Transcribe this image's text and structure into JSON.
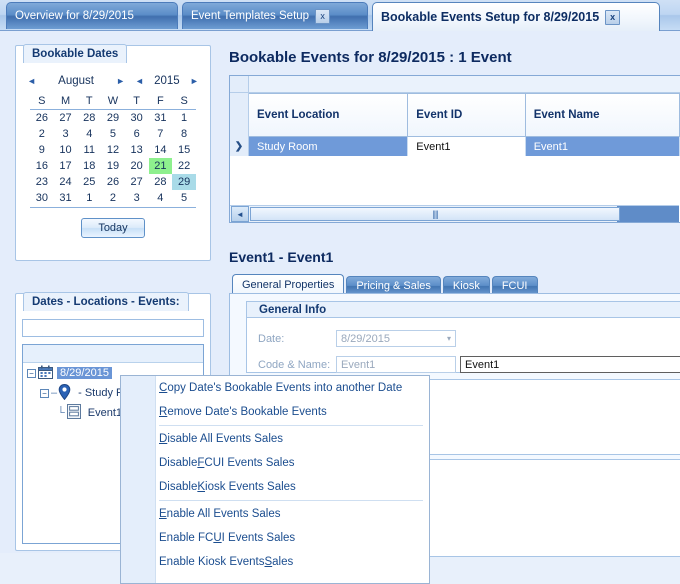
{
  "window_tabs": [
    {
      "label": "Overview for 8/29/2015",
      "closable": false,
      "active": false
    },
    {
      "label": "Event Templates Setup",
      "closable": true,
      "close_label": "x",
      "active": false
    },
    {
      "label": "Bookable Events Setup for 8/29/2015",
      "closable": true,
      "close_label": "x",
      "active": true
    }
  ],
  "bookable_dates": {
    "group_title": "Bookable Dates",
    "calendar": {
      "month": "August",
      "year": "2015",
      "prev_month_icon": "◄",
      "next_month_icon": "►",
      "prev_year_icon": "◄",
      "next_year_icon": "►",
      "daynames": [
        "S",
        "M",
        "T",
        "W",
        "T",
        "F",
        "S"
      ],
      "weeks": [
        [
          {
            "d": "26"
          },
          {
            "d": "27"
          },
          {
            "d": "28"
          },
          {
            "d": "29"
          },
          {
            "d": "30"
          },
          {
            "d": "31"
          },
          {
            "d": "1"
          }
        ],
        [
          {
            "d": "2"
          },
          {
            "d": "3"
          },
          {
            "d": "4"
          },
          {
            "d": "5"
          },
          {
            "d": "6"
          },
          {
            "d": "7"
          },
          {
            "d": "8"
          }
        ],
        [
          {
            "d": "9"
          },
          {
            "d": "10"
          },
          {
            "d": "11"
          },
          {
            "d": "12"
          },
          {
            "d": "13"
          },
          {
            "d": "14"
          },
          {
            "d": "15"
          }
        ],
        [
          {
            "d": "16"
          },
          {
            "d": "17"
          },
          {
            "d": "18"
          },
          {
            "d": "19"
          },
          {
            "d": "20"
          },
          {
            "d": "21",
            "hl": "green"
          },
          {
            "d": "22"
          }
        ],
        [
          {
            "d": "23"
          },
          {
            "d": "24"
          },
          {
            "d": "25"
          },
          {
            "d": "26"
          },
          {
            "d": "27"
          },
          {
            "d": "28"
          },
          {
            "d": "29",
            "hl": "blue"
          }
        ],
        [
          {
            "d": "30"
          },
          {
            "d": "31"
          },
          {
            "d": "1"
          },
          {
            "d": "2"
          },
          {
            "d": "3"
          },
          {
            "d": "4"
          },
          {
            "d": "5"
          }
        ]
      ],
      "today_button": "Today",
      "highlight_colors": {
        "selected_green": "#8ef08e",
        "active_blue": "#a9dbe8"
      }
    }
  },
  "tree_panel": {
    "group_title": "Dates - Locations - Events:",
    "search_value": "",
    "nodes": [
      {
        "icon": "calendar-icon",
        "label": "8/29/2015",
        "selected": true,
        "expander": "−"
      },
      {
        "icon": "map-pin-icon",
        "label": "- Study Room",
        "selected": false,
        "expander": "−"
      },
      {
        "icon": "event-card-icon",
        "label": "Event1",
        "selected": false,
        "expander": ""
      }
    ]
  },
  "events_grid": {
    "title": "Bookable Events for 8/29/2015  :  1 Event",
    "columns": [
      "Event Location",
      "Event ID",
      "Event Name"
    ],
    "row_indicator": "❯",
    "rows": [
      {
        "location": "Study Room",
        "id": "Event1",
        "name": "Event1"
      }
    ],
    "scrollbar": {
      "left_arrow": "◄",
      "grip": "||||"
    }
  },
  "detail": {
    "title": "Event1  -  Event1",
    "tabs": [
      {
        "label": "General Properties",
        "active": true
      },
      {
        "label": "Pricing & Sales",
        "active": false
      },
      {
        "label": "Kiosk",
        "active": false
      },
      {
        "label": "FCUI",
        "active": false
      }
    ],
    "general_info": {
      "section_title": "General Info",
      "date_label": "Date:",
      "date_value": "8/29/2015",
      "date_dropdown_icon": "▾",
      "code_name_label": "Code & Name:",
      "code_value": "Event1",
      "name_value": "Event1"
    }
  },
  "context_menu": {
    "items": [
      {
        "pre": "",
        "accel": "C",
        "post": "opy Date's Bookable Events into another Date"
      },
      {
        "pre": "",
        "accel": "R",
        "post": "emove Date's Bookable Events"
      },
      {
        "separator": true
      },
      {
        "pre": "",
        "accel": "D",
        "post": "isable All Events Sales"
      },
      {
        "pre": "Disable ",
        "accel": "F",
        "post": "CUI Events Sales"
      },
      {
        "pre": "Disable ",
        "accel": "K",
        "post": "iosk Events Sales"
      },
      {
        "separator": true
      },
      {
        "pre": "",
        "accel": "E",
        "post": "nable All Events Sales"
      },
      {
        "pre": "Enable FC",
        "accel": "U",
        "post": "I Events Sales"
      },
      {
        "pre": "Enable Kiosk Events ",
        "accel": "S",
        "post": "ales"
      }
    ]
  }
}
